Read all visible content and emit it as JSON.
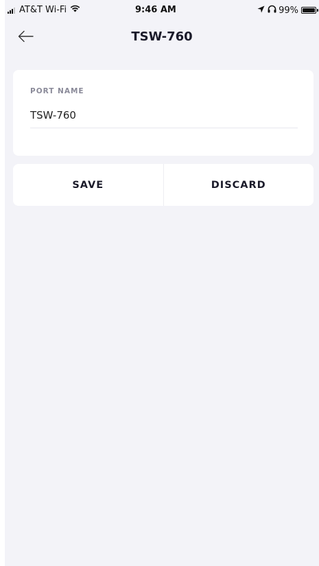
{
  "status_bar": {
    "carrier": "AT&T Wi-Fi",
    "time": "9:46 AM",
    "battery_percent": "99%",
    "battery_level": 0.99,
    "icons": [
      "signal-icon",
      "wifi-icon",
      "location-icon",
      "headphones-icon",
      "battery-icon"
    ]
  },
  "nav": {
    "title": "TSW-760",
    "back_icon": "arrow-left-icon"
  },
  "form": {
    "port_name_label": "PORT NAME",
    "port_name_value": "TSW-760"
  },
  "actions": {
    "save_label": "SAVE",
    "discard_label": "DISCARD"
  },
  "colors": {
    "background": "#f3f3f8",
    "card": "#ffffff",
    "text_primary": "#1b1b2a",
    "label_muted": "#8a8a99"
  }
}
